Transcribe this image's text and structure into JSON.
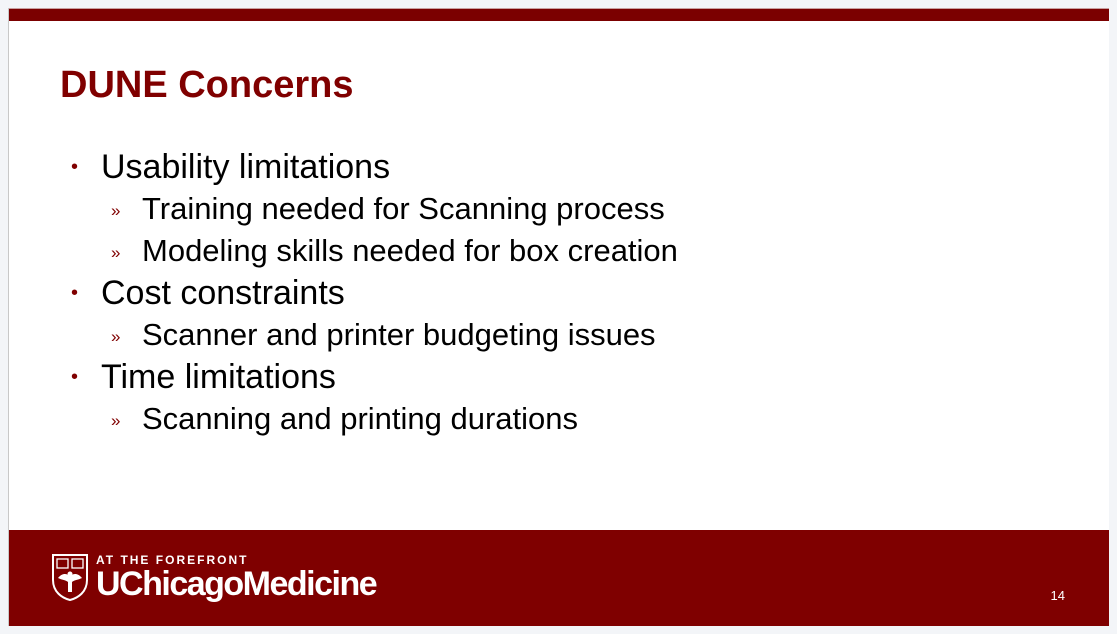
{
  "slide": {
    "title": "DUNE Concerns",
    "bullets": [
      {
        "text": "Usability limitations",
        "subs": [
          "Training needed for Scanning process",
          "Modeling skills needed for box creation"
        ]
      },
      {
        "text": "Cost constraints",
        "subs": [
          "Scanner and printer budgeting issues"
        ]
      },
      {
        "text": "Time limitations",
        "subs": [
          "Scanning and printing durations"
        ]
      }
    ],
    "bullet_glyph": "•",
    "sub_glyph": "»",
    "page_number": "14"
  },
  "footer": {
    "tagline": "AT THE FOREFRONT",
    "brand": "UChicagoMedicine"
  },
  "colors": {
    "accent": "#7f0000",
    "title": "#800000"
  }
}
